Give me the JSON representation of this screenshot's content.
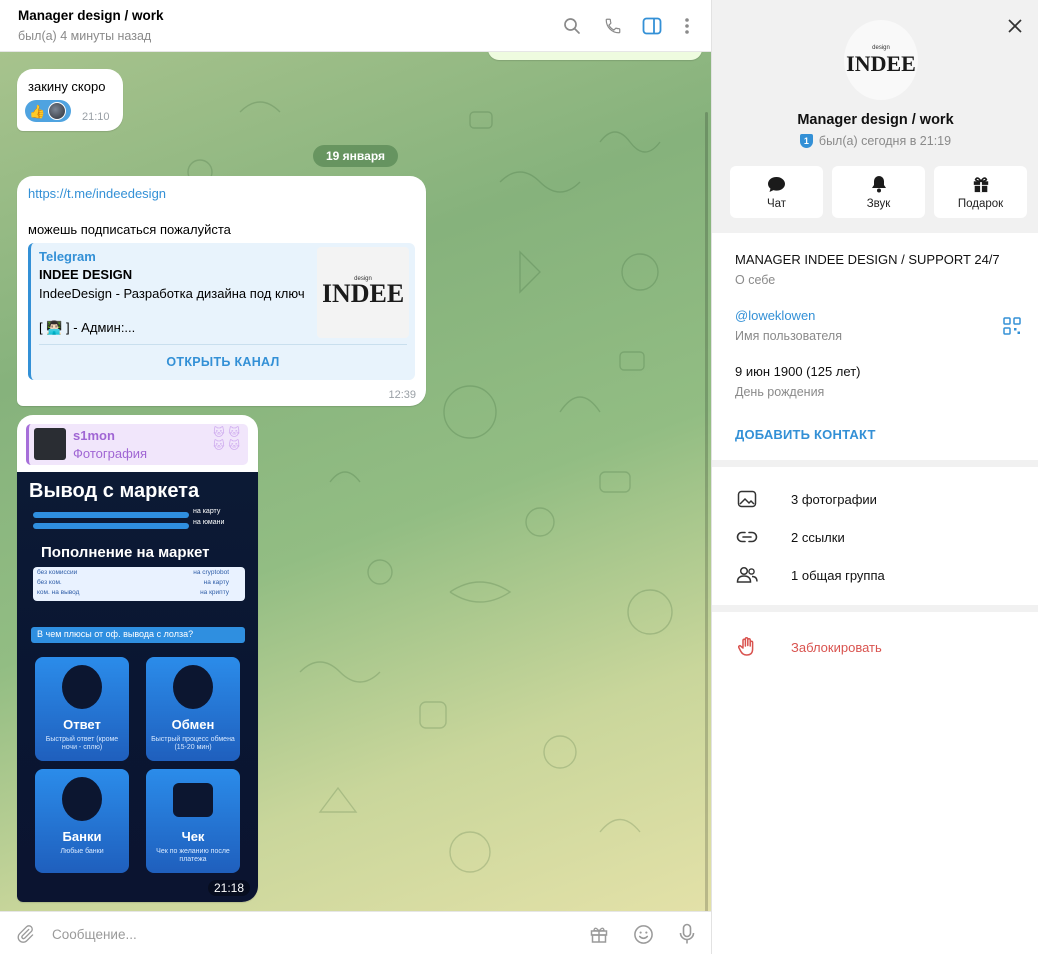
{
  "header": {
    "title": "Manager design / work",
    "status": "был(а) 4 минуты назад",
    "icons": [
      "search-icon",
      "phone-icon",
      "sidebar-toggle-icon",
      "more-vertical-icon"
    ]
  },
  "messages": [
    {
      "id": "m1",
      "text": "закину скоро",
      "reaction": "👍",
      "time": "21:10"
    },
    {
      "id": "m2",
      "link": "https://t.me/indeedesign",
      "text": "можешь подписаться пожалуйста",
      "preview": {
        "site": "Telegram",
        "title": "INDEE DESIGN",
        "description": "IndeeDesign - Разработка дизайна под ключ",
        "admin_line": "[ 👨🏻‍💻 ] - Админ:...",
        "thumb_text": "INDEE",
        "button": "ОТКРЫТЬ КАНАЛ"
      },
      "time": "12:39"
    },
    {
      "id": "m3",
      "forward": {
        "name": "s1mon",
        "type": "Фотография"
      },
      "photo": {
        "heading1": "Вывод с маркета",
        "row1a": "на карту",
        "row1b": "на юмани",
        "heading2": "Пополнение на маркет",
        "fees": [
          {
            "left": "без комиссии",
            "right": "на cryptobot"
          },
          {
            "left": "без ком.",
            "right": "на карту"
          },
          {
            "left": "ком. на вывод",
            "right": "на крипту"
          }
        ],
        "question": "В чем плюсы от оф. вывода с лолза?",
        "cards": [
          {
            "title": "Ответ",
            "sub": "Быстрый ответ (кроме ночи - сплю)"
          },
          {
            "title": "Обмен",
            "sub": "Быстрый процесс обмена (15-20 мин)"
          },
          {
            "title": "Банки",
            "sub": "Любые банки"
          },
          {
            "title": "Чек",
            "sub": "Чек по желанию после платежа"
          }
        ]
      },
      "time": "21:18"
    }
  ],
  "date_separator": "19 января",
  "composer": {
    "placeholder": "Сообщение..."
  },
  "profile": {
    "avatar_text": "INDEE",
    "name": "Manager design / work",
    "badge": "1",
    "status": "был(а) сегодня в 21:19",
    "actions": [
      {
        "label": "Чат",
        "icon": "chat-bubble-icon"
      },
      {
        "label": "Звук",
        "icon": "bell-icon"
      },
      {
        "label": "Подарок",
        "icon": "gift-icon"
      }
    ],
    "bio": "MANAGER INDEE DESIGN / SUPPORT 24/7",
    "bio_label": "О себе",
    "username": "@loweklowen",
    "username_label": "Имя пользователя",
    "birthday": "9 июн 1900 (125 лет)",
    "birthday_label": "День рождения",
    "add_contact": "ДОБАВИТЬ КОНТАКТ",
    "media": [
      {
        "label": "3 фотографии",
        "icon": "photo-icon"
      },
      {
        "label": "2 ссылки",
        "icon": "link-icon"
      },
      {
        "label": "1 общая группа",
        "icon": "group-icon"
      }
    ],
    "block": "Заблокировать"
  },
  "colors": {
    "accent": "#3390d6",
    "danger": "#d9534f",
    "forward": "#a066d4"
  }
}
